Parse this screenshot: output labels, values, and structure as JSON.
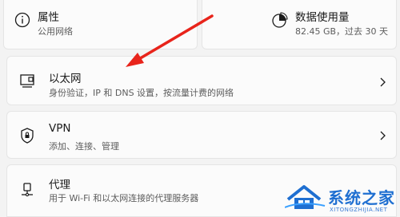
{
  "properties": {
    "title": "属性",
    "subtitle": "公用网络",
    "icon": "info-icon"
  },
  "data_usage": {
    "title": "数据使用量",
    "subtitle": "82.45 GB，过去 30 天",
    "icon": "pie-chart-icon"
  },
  "rows": [
    {
      "title": "以太网",
      "subtitle": "身份验证，IP 和 DNS 设置，按流量计费的网络",
      "icon": "ethernet-icon"
    },
    {
      "title": "VPN",
      "subtitle": "添加、连接、管理",
      "icon": "shield-icon"
    },
    {
      "title": "代理",
      "subtitle": "用于 Wi-Fi 和以太网连接的代理服务器",
      "icon": "proxy-icon"
    }
  ],
  "watermark": {
    "text": "系统之家",
    "url": "XITONGZHIJIA.NET"
  },
  "colors": {
    "arrow": "#e8241b",
    "watermark": "#1f6fd1"
  }
}
